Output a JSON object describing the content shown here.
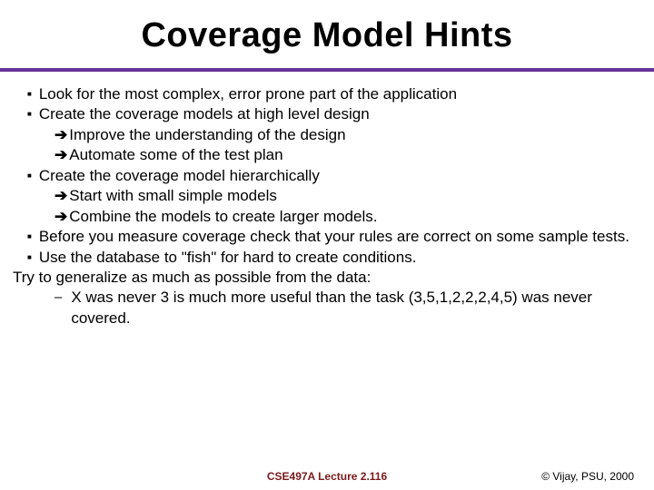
{
  "title": "Coverage Model Hints",
  "bullets": {
    "b1": "Look for the most complex, error prone part of the application",
    "b2": "Create the coverage models at high level design",
    "b2s1": "Improve the understanding of the design",
    "b2s2": "Automate some of the test plan",
    "b3": "Create the coverage model hierarchically",
    "b3s1": "Start with small simple models",
    "b3s2": "Combine the models to create larger models.",
    "b4": "Before you measure coverage check that your rules are correct on some sample tests.",
    "b5": "Use the database to \"fish\" for hard to create conditions.",
    "plain1": "Try to generalize as much as possible from the data:",
    "dash1": "X was never 3 is much more useful than the task (3,5,1,2,2,2,4,5) was never covered."
  },
  "glyphs": {
    "square": "■",
    "arrow": "➔",
    "dash": "–"
  },
  "footer": {
    "center": "CSE497A Lecture 2.116",
    "right": "© Vijay, PSU, 2000"
  }
}
